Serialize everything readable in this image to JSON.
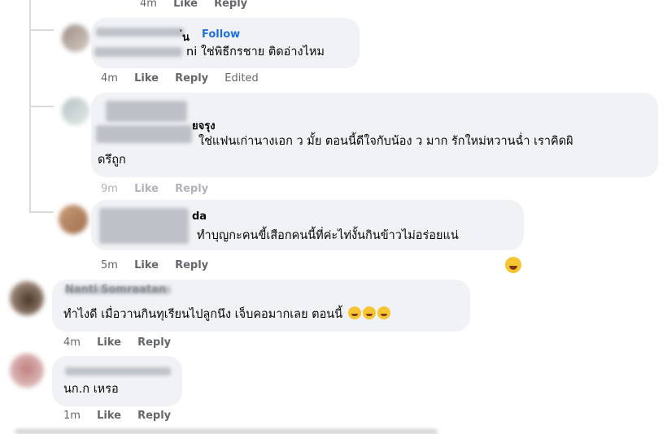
{
  "top_actions": {
    "time": "4m",
    "like": "Like",
    "reply": "Reply"
  },
  "comments": [
    {
      "name_suffix": "่น",
      "follow": "Follow",
      "text_suffix": "ni ใช่พิธีกรชาย ติดอ่างไหม",
      "time": "4m",
      "like": "Like",
      "reply": "Reply",
      "edited": "Edited"
    },
    {
      "name_suffix": "ยจรุง",
      "text_line1": "ใช่แฟนเก่านางเอก ว มั้ย ตอนนี้ดีใจกับน้อง ว มาก รักใหม่หวานฉ่ำ เราคิดผิ",
      "text_line2": "ดรึถูก",
      "time": "9m",
      "like": "Like",
      "reply": "Reply"
    },
    {
      "name_suffix": "da",
      "text": "ทำบุญกะคนขี้เสือกคนนี้ที่ค่ะไท่งั้นกินข้าวไม่อร่อยแน่",
      "time": "5m",
      "like": "Like",
      "reply": "Reply",
      "reaction_icon": "laughing-emoji-icon"
    },
    {
      "name": "Nanti Somraatan",
      "text": "ทำไงดี เมื่อวานกินทุเรียนไปลูกนึง เจ็บคอมากเลย ตอนนี้",
      "time": "4m",
      "like": "Like",
      "reply": "Reply"
    },
    {
      "text": "นก.ก เหรอ",
      "time": "1m",
      "like": "Like",
      "reply": "Reply"
    }
  ],
  "colors": {
    "bubble": "#f0f2f5",
    "link": "#216fdb",
    "meta": "#65676b",
    "thread_line": "#d8dadf"
  }
}
